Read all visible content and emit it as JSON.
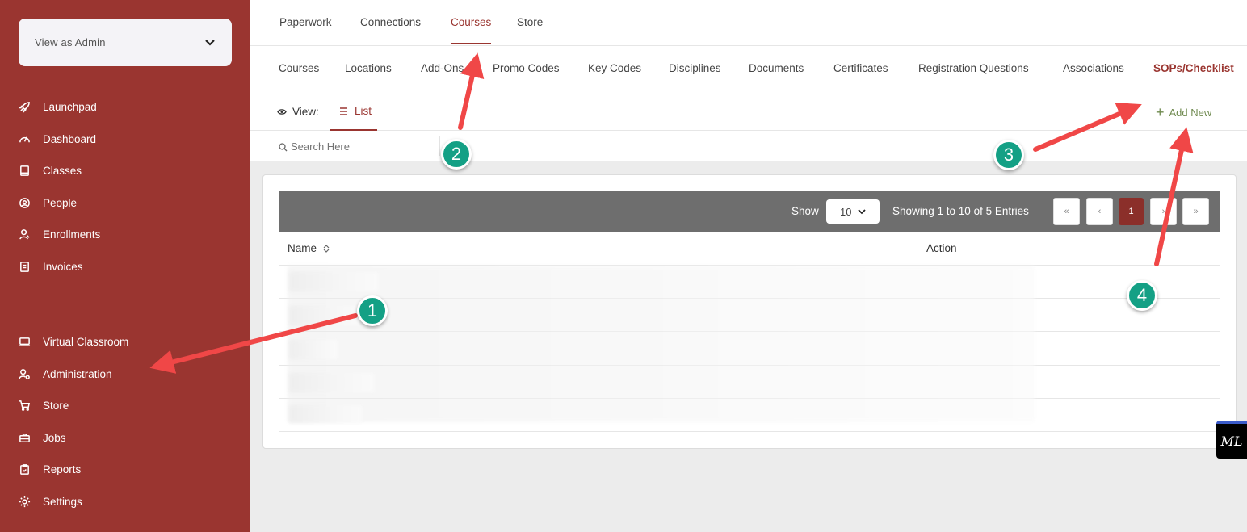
{
  "sidebar": {
    "role_label": "View as Admin",
    "items": [
      {
        "label": "Launchpad",
        "icon": "rocket-icon"
      },
      {
        "label": "Dashboard",
        "icon": "gauge-icon"
      },
      {
        "label": "Classes",
        "icon": "book-icon"
      },
      {
        "label": "People",
        "icon": "user-circle-icon"
      },
      {
        "label": "Enrollments",
        "icon": "user-icon"
      },
      {
        "label": "Invoices",
        "icon": "invoice-icon"
      },
      {
        "label": "Virtual Classroom",
        "icon": "screen-icon"
      },
      {
        "label": "Administration",
        "icon": "user-gear-icon"
      },
      {
        "label": "Store",
        "icon": "cart-icon"
      },
      {
        "label": "Jobs",
        "icon": "briefcase-icon"
      },
      {
        "label": "Reports",
        "icon": "clipboard-icon"
      },
      {
        "label": "Settings",
        "icon": "gear-icon"
      }
    ]
  },
  "top_tabs": [
    "Paperwork",
    "Connections",
    "Courses",
    "Store"
  ],
  "top_active": "Courses",
  "sub_tabs": [
    "Courses",
    "Locations",
    "Add-Ons",
    "Promo Codes",
    "Key Codes",
    "Disciplines",
    "Documents",
    "Certificates",
    "Registration Questions",
    "Associations",
    "SOPs/Checklist"
  ],
  "sub_active": "SOPs/Checklist",
  "view": {
    "label": "View:",
    "list_label": "List",
    "add_new": "Add New"
  },
  "search": {
    "placeholder": "Search Here"
  },
  "table": {
    "show_label": "Show",
    "page_size": "10",
    "entries_text": "Showing 1 to 10 of 5 Entries",
    "pagination": [
      "«",
      "‹",
      "1",
      "›",
      "»"
    ],
    "current_page": "1",
    "columns": [
      "Name",
      "Action"
    ]
  },
  "annotations": [
    "1",
    "2",
    "3",
    "4"
  ],
  "widget": {
    "label": "ML"
  },
  "colors": {
    "brand": "#9a3530",
    "annotation": "#14a085",
    "arrow": "#f04747"
  }
}
